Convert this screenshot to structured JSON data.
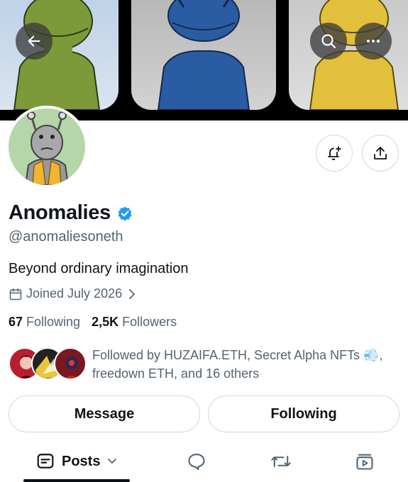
{
  "header": {
    "back_icon": "arrow-left-icon",
    "search_icon": "search-icon",
    "more_icon": "more-horizontal-icon"
  },
  "banner": {
    "panels": [
      {
        "color": "#7c9a3a"
      },
      {
        "color": "#2a5ca3"
      },
      {
        "color": "#e3c03b"
      }
    ]
  },
  "profile": {
    "name": "Anomalies",
    "handle": "@anomaliesoneth",
    "bio": "Beyond ordinary imagination",
    "joined": "Joined July 2026",
    "following_count": "67",
    "following_label": "Following",
    "followers_count": "2,5K",
    "followers_label": "Followers",
    "verified_color": "#1d9bf0"
  },
  "followed_by": {
    "text": "Followed by HUZAIFA.ETH, Secret Alpha NFTs 💨,",
    "text_line2": "freedown ETH, and 16 others"
  },
  "actions": {
    "message_label": "Message",
    "following_label": "Following"
  },
  "tabs": {
    "posts_label": "Posts",
    "items": [
      "posts-tab",
      "replies-tab",
      "reposts-tab",
      "media-tab"
    ]
  }
}
